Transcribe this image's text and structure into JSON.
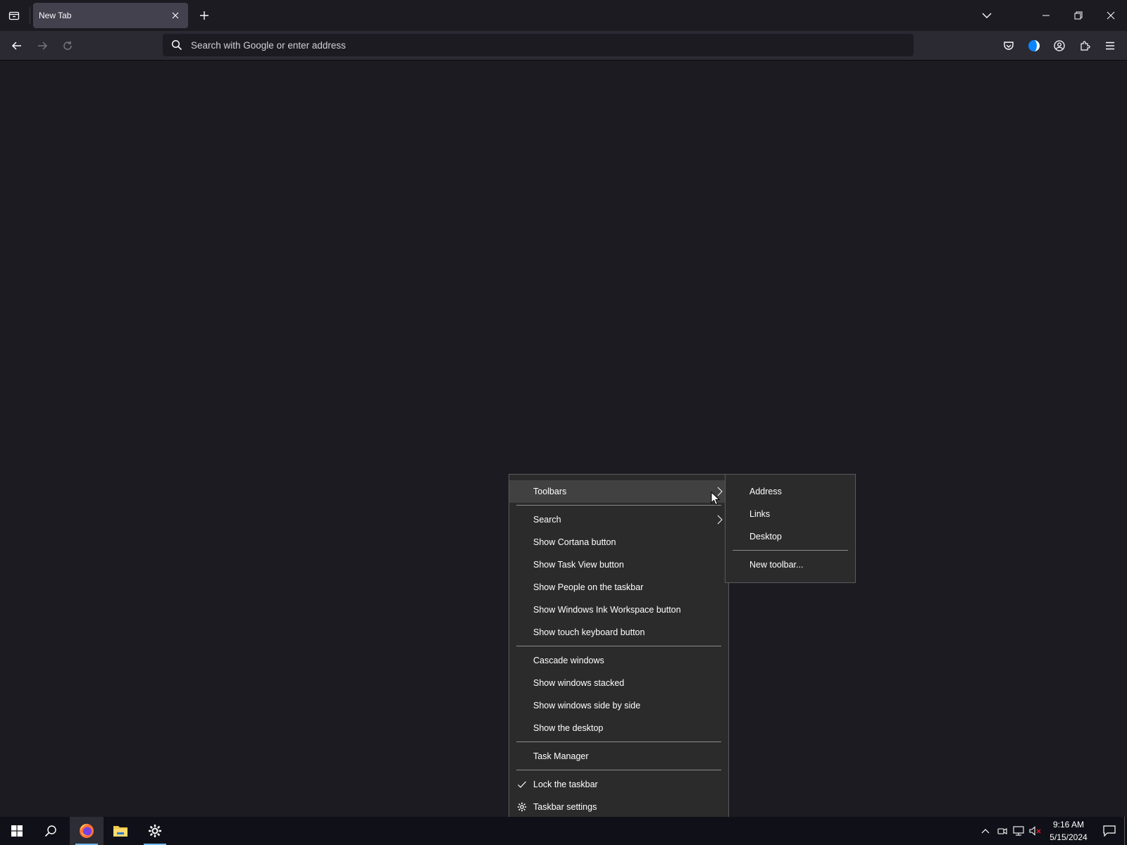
{
  "browser": {
    "tab": {
      "title": "New Tab"
    },
    "urlbar": {
      "placeholder": "Search with Google or enter address"
    }
  },
  "context_menu": {
    "items": [
      {
        "label": "Toolbars",
        "has_submenu": true,
        "highlighted": true
      },
      {
        "label": "Search",
        "has_submenu": true
      },
      {
        "label": "Show Cortana button"
      },
      {
        "label": "Show Task View button"
      },
      {
        "label": "Show People on the taskbar"
      },
      {
        "label": "Show Windows Ink Workspace button"
      },
      {
        "label": "Show touch keyboard button"
      },
      {
        "label": "Cascade windows"
      },
      {
        "label": "Show windows stacked"
      },
      {
        "label": "Show windows side by side"
      },
      {
        "label": "Show the desktop"
      },
      {
        "label": "Task Manager"
      },
      {
        "label": "Lock the taskbar",
        "checked": true
      },
      {
        "label": "Taskbar settings",
        "icon": "gear-icon"
      }
    ]
  },
  "toolbars_submenu": {
    "items": [
      {
        "label": "Address"
      },
      {
        "label": "Links"
      },
      {
        "label": "Desktop"
      },
      {
        "label": "New toolbar..."
      }
    ]
  },
  "taskbar": {
    "apps": [
      {
        "name": "start-icon"
      },
      {
        "name": "search-icon"
      },
      {
        "name": "firefox-icon",
        "active": true
      },
      {
        "name": "file-explorer-icon"
      },
      {
        "name": "settings-icon",
        "running": true
      }
    ],
    "clock": {
      "time": "9:16 AM",
      "date": "5/15/2024"
    }
  },
  "colors": {
    "accent": "#76b9ed",
    "menu_bg": "#2b2b2b",
    "page_bg": "#1c1b22"
  }
}
